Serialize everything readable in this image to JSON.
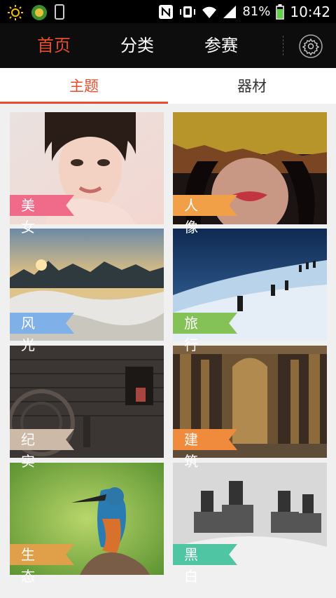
{
  "status_bar": {
    "battery_percent": "81%",
    "time": "10:42"
  },
  "top_nav": {
    "tabs": [
      {
        "label": "首页",
        "active": true
      },
      {
        "label": "分类",
        "active": false
      },
      {
        "label": "参赛",
        "active": false
      }
    ],
    "settings_icon": "gear-icon"
  },
  "sub_tabs": [
    {
      "label": "主题",
      "active": true
    },
    {
      "label": "器材",
      "active": false
    }
  ],
  "categories": [
    {
      "label": "美女",
      "ribbon_color": "#f06a8a"
    },
    {
      "label": "人像",
      "ribbon_color": "#f2a048"
    },
    {
      "label": "风光",
      "ribbon_color": "#7fb0e8"
    },
    {
      "label": "旅行",
      "ribbon_color": "#84c257"
    },
    {
      "label": "纪实",
      "ribbon_color": "#cdb9a8"
    },
    {
      "label": "建筑",
      "ribbon_color": "#f08a3c"
    },
    {
      "label": "生态",
      "ribbon_color": "#e0a04a"
    },
    {
      "label": "黑白",
      "ribbon_color": "#4fc5a3"
    }
  ],
  "colors": {
    "accent": "#e74c2c"
  }
}
